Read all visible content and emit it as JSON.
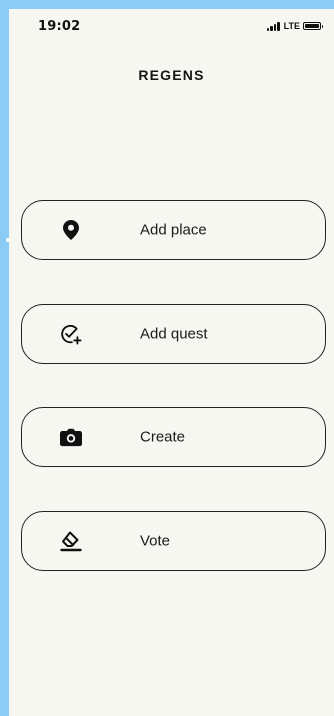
{
  "status_bar": {
    "time": "19:02",
    "network": "LTE",
    "battery_level": 1
  },
  "brand": {
    "title": "REGENS"
  },
  "actions": [
    {
      "label": "Add place",
      "icon": "map-pin-icon"
    },
    {
      "label": "Add quest",
      "icon": "check-circle-plus-icon"
    },
    {
      "label": "Create",
      "icon": "camera-icon"
    },
    {
      "label": "Vote",
      "icon": "eraser-icon"
    }
  ],
  "colors": {
    "frame_background": "#8ccbf6",
    "screen_background": "#f7f7f2",
    "text": "#1b1b1b",
    "border": "#222222"
  }
}
